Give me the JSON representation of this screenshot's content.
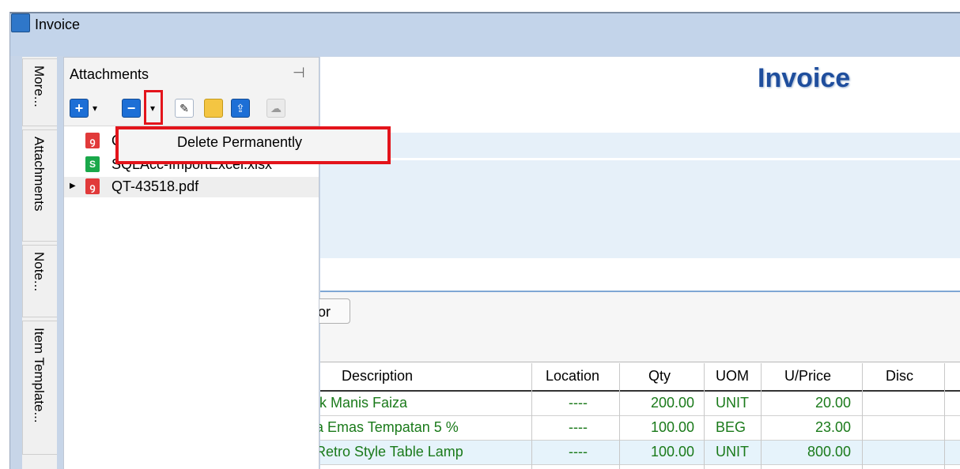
{
  "window": {
    "title": "Invoice",
    "icon": "app-icon"
  },
  "side_tabs": [
    "More...",
    "Attachments",
    "Note...",
    "Item Template..."
  ],
  "attachments": {
    "title": "Attachments",
    "pin_icon": "pin-icon",
    "toolbar": {
      "add_icon": "+",
      "remove_icon": "−",
      "dropdown": "▾",
      "edit_icon": "✎",
      "folder_icon": "folder-icon",
      "upload_icon": "upload-icon",
      "cloud_icon": "cloud-icon"
    },
    "files": [
      {
        "name": "Q",
        "type": "pdf"
      },
      {
        "name": "SQLAcc-ImportExcel.xlsx",
        "type": "xlsx"
      },
      {
        "name": "QT-43518.pdf",
        "type": "pdf",
        "selected": true
      }
    ],
    "file_icon_labels": {
      "pdf": "ꝯ",
      "xlsx": "S"
    },
    "expander": "▶"
  },
  "context_menu": {
    "items": [
      "Delete Permanently"
    ]
  },
  "main": {
    "doc_title": "Invoice",
    "partial_button": "or",
    "grid": {
      "columns": [
        "Description",
        "Location",
        "Qty",
        "UOM",
        "U/Price",
        "Disc"
      ],
      "rows": [
        {
          "description": "ık Manis Faiza",
          "location": "----",
          "qty": "200.00",
          "uom": "UNIT",
          "uprice": "20.00",
          "disc": ""
        },
        {
          "description": "a Emas Tempatan 5 %",
          "location": "----",
          "qty": "100.00",
          "uom": "BEG",
          "uprice": "23.00",
          "disc": ""
        },
        {
          "description": "Retro Style Table Lamp",
          "location": "----",
          "qty": "100.00",
          "uom": "UNIT",
          "uprice": "800.00",
          "disc": ""
        }
      ]
    }
  },
  "colors": {
    "accent": "#1d6fd6",
    "highlight": "#e3141b",
    "doc_title": "#1f4e9d",
    "row_text": "#1a7a1a"
  }
}
